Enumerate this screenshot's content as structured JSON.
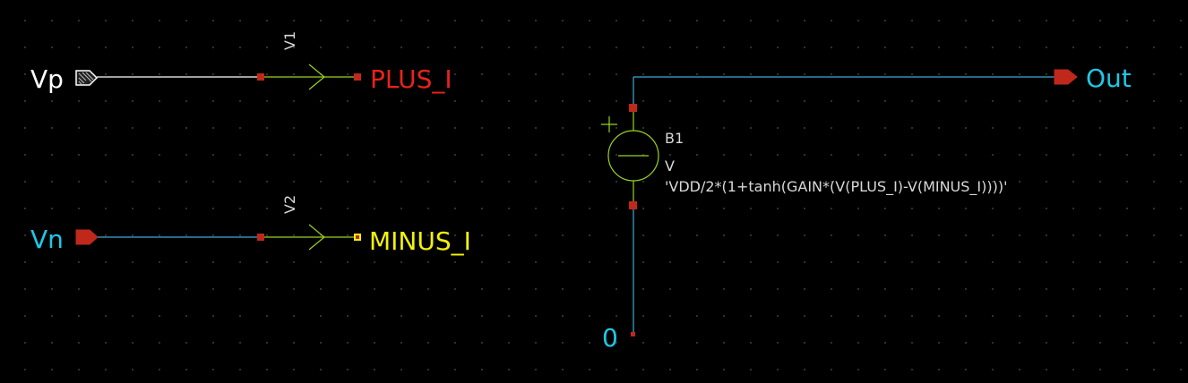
{
  "ports": {
    "vp": "Vp",
    "vn": "Vn",
    "out": "Out",
    "ground": "0"
  },
  "nets": {
    "plus": "PLUS_I",
    "minus": "MINUS_I"
  },
  "sources": {
    "v1": {
      "name": "V1"
    },
    "v2": {
      "name": "V2"
    },
    "b1": {
      "name": "B1",
      "type": "V",
      "expression": "'VDD/2*(1+tanh(GAIN*(V(PLUS_I)-V(MINUS_I))))'"
    }
  },
  "colors": {
    "background": "#000000",
    "wire_white": "#ffffff",
    "wire_blue": "#3fa9d6",
    "component": "#9ad21f",
    "pin": "#c0281c",
    "text_cyan": "#1ec8e6",
    "text_red": "#e8231c",
    "text_yellow": "#f2f20a",
    "text_white": "#ffffff",
    "text_gray": "#d8d8d8"
  }
}
